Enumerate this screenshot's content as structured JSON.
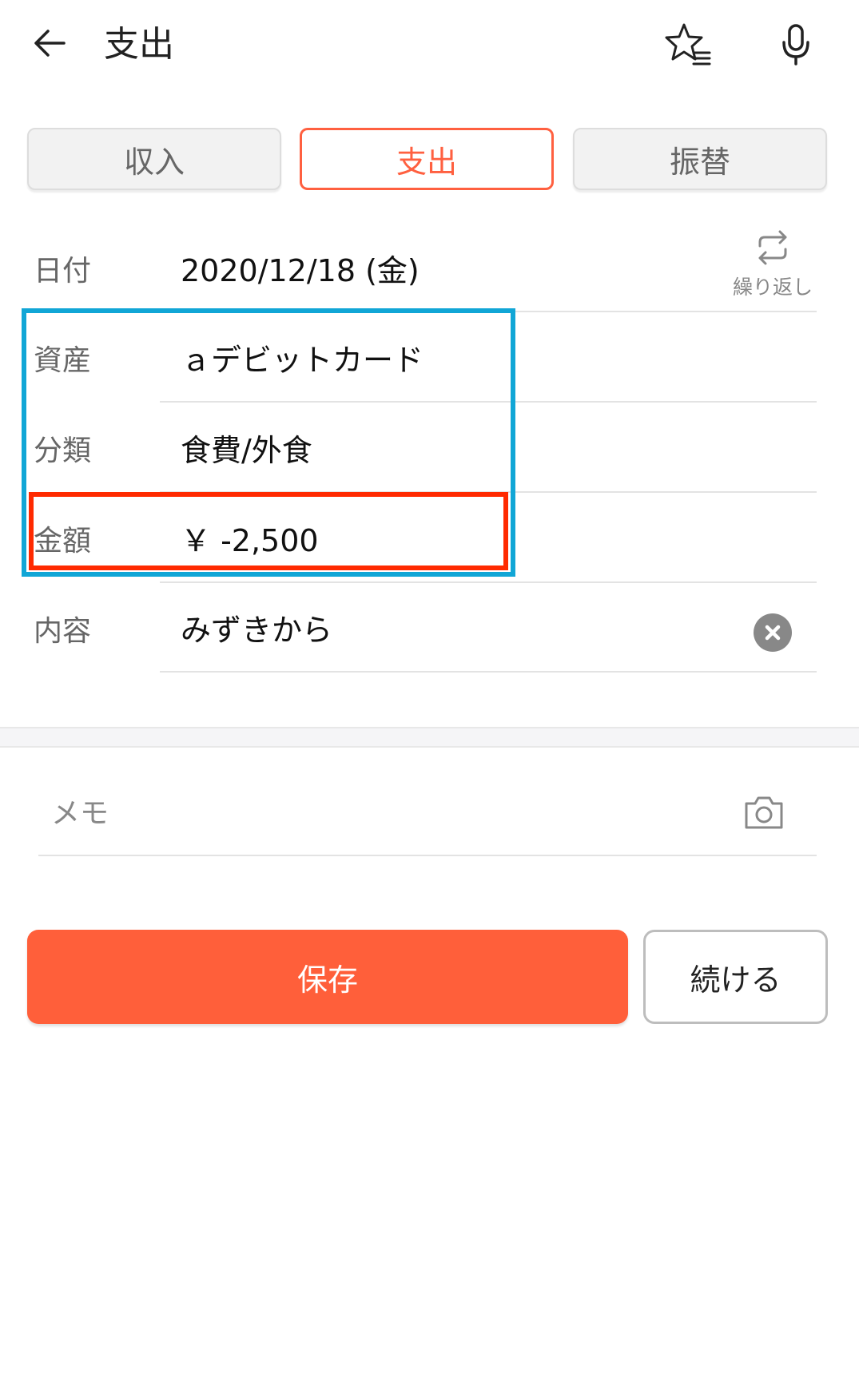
{
  "header": {
    "title": "支出",
    "icons": {
      "back": "arrow-left-icon",
      "favorite": "star-list-icon",
      "voice": "microphone-icon"
    }
  },
  "tabs": [
    {
      "label": "収入",
      "active": false
    },
    {
      "label": "支出",
      "active": true
    },
    {
      "label": "振替",
      "active": false
    }
  ],
  "form": {
    "date": {
      "label": "日付",
      "value": "2020/12/18 (金)"
    },
    "repeat": {
      "label": "繰り返し",
      "icon": "repeat-icon"
    },
    "asset": {
      "label": "資産",
      "value": "ａデビットカード"
    },
    "category": {
      "label": "分類",
      "value": "食費/外食"
    },
    "amount": {
      "label": "金額",
      "value": "￥ -2,500"
    },
    "content": {
      "label": "内容",
      "value": "みずきから",
      "clear_icon": "clear-icon"
    }
  },
  "memo": {
    "placeholder": "メモ",
    "icon": "camera-icon"
  },
  "actions": {
    "save_label": "保存",
    "continue_label": "続ける"
  },
  "colors": {
    "accent": "#ff5f3a",
    "highlight_blue": "#11a6d6",
    "highlight_red": "#ff2a00"
  }
}
